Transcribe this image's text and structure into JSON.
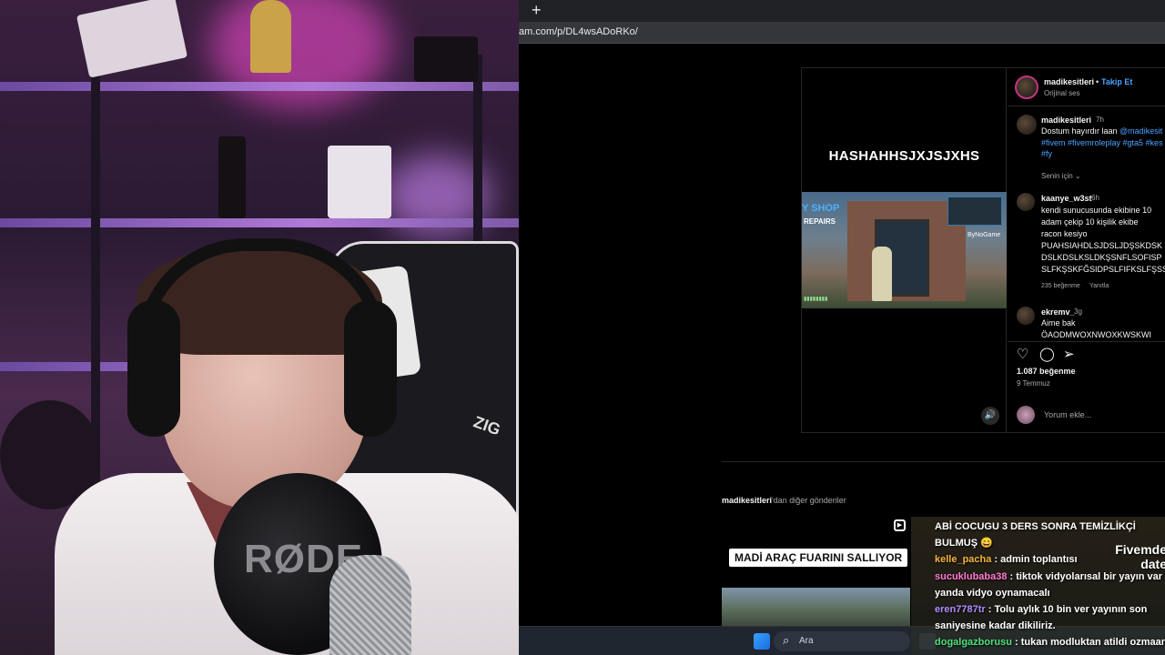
{
  "browser": {
    "new_tab_label": "+",
    "url": "am.com/p/DL4wsADoRKo/"
  },
  "post": {
    "media_caption": "HASHAHHSJXJSJXHS",
    "game_overlay": {
      "shop_sign": "Y SHOP",
      "repairs_sign": "REPAIRS",
      "streamer_brand": "ByNoGame"
    },
    "author": "madikesitleri",
    "follow_label": "Takip Et",
    "audio_label": "Orijinal ses",
    "caption": {
      "author": "madikesitleri",
      "time": "7h",
      "text": "Dostum hayırdır laan ",
      "mention": "@madikesit",
      "hashtags_line1": "#fivem #fivemroleplay #gta5 #kes",
      "hashtags_line2": "#fy"
    },
    "for_you_label": "Senin için",
    "comments": [
      {
        "user": "kaanye_w3st",
        "time": "6h",
        "lines": [
          "kendi sunucusunda ekibine 10",
          "adam çekip 10 kişilik ekibe",
          "racon kesiyo",
          "PUAHSIAHDLSJDSLJDŞSKDSK",
          "DSLKDSLKSLDKŞSNFLSOFISP",
          "SLFKŞSKFĞSIDPSLFIFKSLFŞSS"
        ],
        "likes": "235 beğenme",
        "reply": "Yanıtla"
      },
      {
        "user": "ekremv_",
        "time": "3g",
        "lines": [
          "Aime bak",
          "ÖAODMWOXNWOXKWSKWI"
        ]
      }
    ],
    "likes_count": "1.087 beğenme",
    "date": "9 Temmuz",
    "comment_placeholder": "Yorum ekle..."
  },
  "more_posts": {
    "author": "madikesitleri",
    "suffix": "'dan diğer gönderiler",
    "thumb_label": "MADİ ARAÇ FUARINI SALLIYOR"
  },
  "taskbar": {
    "search_placeholder": "Ara"
  },
  "chat": {
    "messages": [
      {
        "user": "",
        "text": "ABİ COCUGU 3 DERS SONRA TEMİZLİKÇİ",
        "color": "#ffffff"
      },
      {
        "user": "",
        "text": "BULMUŞ 😄",
        "color": "#ffffff"
      },
      {
        "user": "kelle_pacha",
        "text": ": admin toplantısı",
        "color": "#f4b43c"
      },
      {
        "user": "sucuklubaba38",
        "text": ": tiktok vidyolarısal bir yayın var",
        "color": "#ff7ad0"
      },
      {
        "user": "",
        "text": "yanda vidyo oynamacalı",
        "color": "#ffffff"
      },
      {
        "user": "eren7787tr",
        "text": ": Tolu aylık 10 bin ver yayının son",
        "color": "#b08cff"
      },
      {
        "user": "",
        "text": "saniyesine kadar dikiliriz.",
        "color": "#ffffff"
      },
      {
        "user": "dogalgazborusu",
        "text": ": tukan modluktan atildi ozmaan",
        "color": "#4ee07a"
      }
    ],
    "promo_line1": "Fivemde",
    "promo_line2": "date"
  },
  "webcam": {
    "mic_brand": "RØDE",
    "chair_brand": "ZIG"
  },
  "colors": {
    "instagram_link": "#4da3ff",
    "browser_bg": "#000000",
    "tabstrip": "#202124"
  }
}
